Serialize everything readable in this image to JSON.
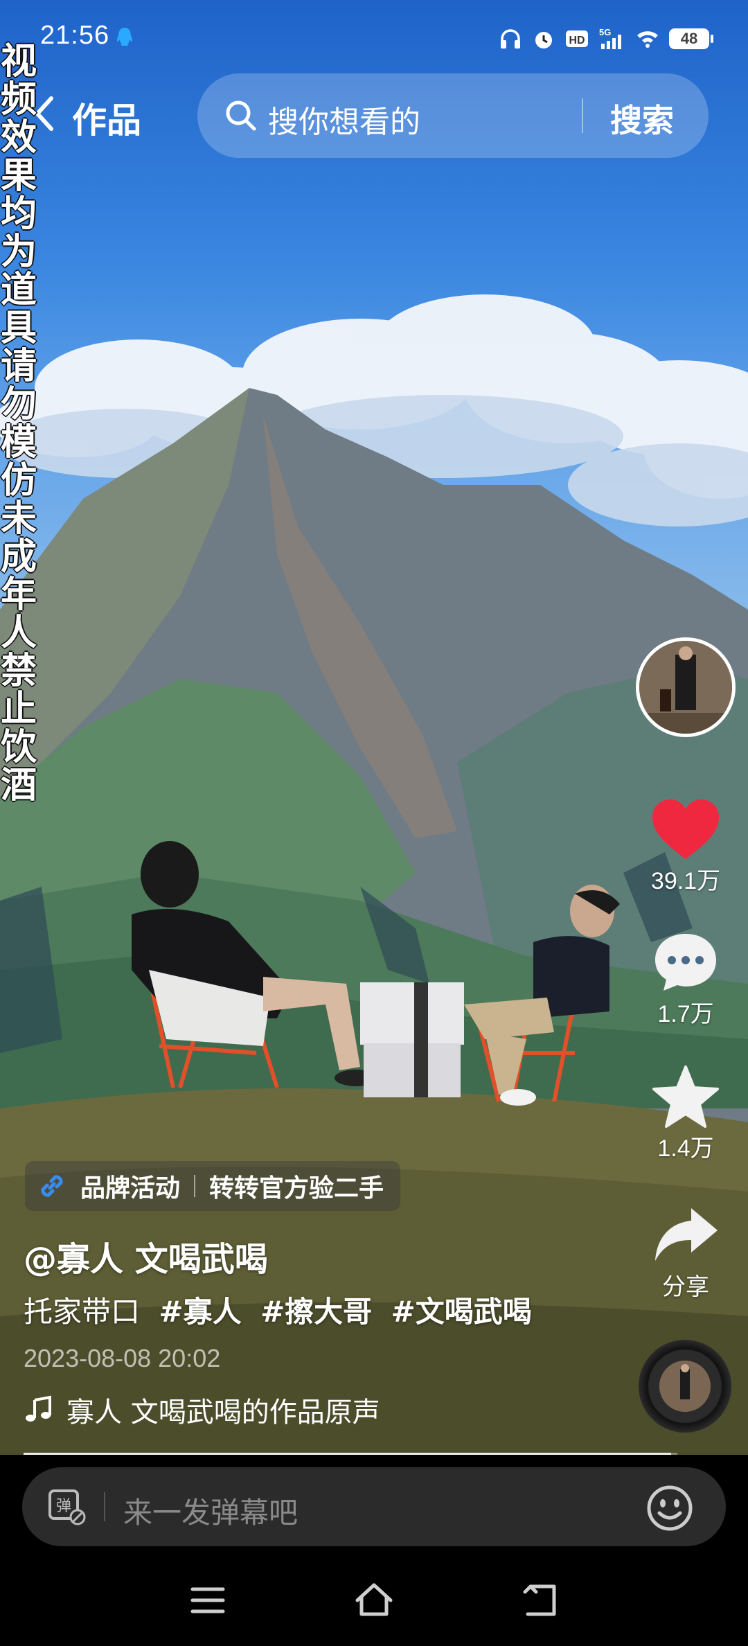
{
  "status_bar": {
    "time": "21:56",
    "battery": "48",
    "network": "5G"
  },
  "nav": {
    "title": "作品",
    "search_placeholder": "搜你想看的",
    "search_button": "搜索"
  },
  "warning_text": "视频效果均为道具请勿模仿未成年人禁止饮酒",
  "actions": {
    "likes": "39.1万",
    "comments": "1.7万",
    "favorites": "1.4万",
    "share": "分享"
  },
  "brand": {
    "tag": "品牌活动",
    "text": "转转官方验二手"
  },
  "video_info": {
    "author": "@寡人 文喝武喝",
    "description": "托家带口",
    "hashtags": [
      "#寡人",
      "#擦大哥",
      "#文喝武喝"
    ],
    "date": "2023-08-08 20:02",
    "music": "寡人 文喝武喝的作品原声",
    "progress": 0.99
  },
  "comment_bar": {
    "placeholder": "来一发弹幕吧"
  },
  "icons": {
    "status": [
      "qq-icon",
      "headphone-icon",
      "alarm-icon",
      "hd-icon",
      "signal-icon",
      "wifi-icon",
      "battery-icon"
    ],
    "actions": [
      "heart-icon",
      "comment-icon",
      "star-icon",
      "share-icon"
    ],
    "system_nav": [
      "menu-icon",
      "home-icon",
      "back-icon"
    ]
  },
  "colors": {
    "like": "#f0283f",
    "sky": "#2c74d8",
    "comment_bar": "#2b2b2b"
  }
}
